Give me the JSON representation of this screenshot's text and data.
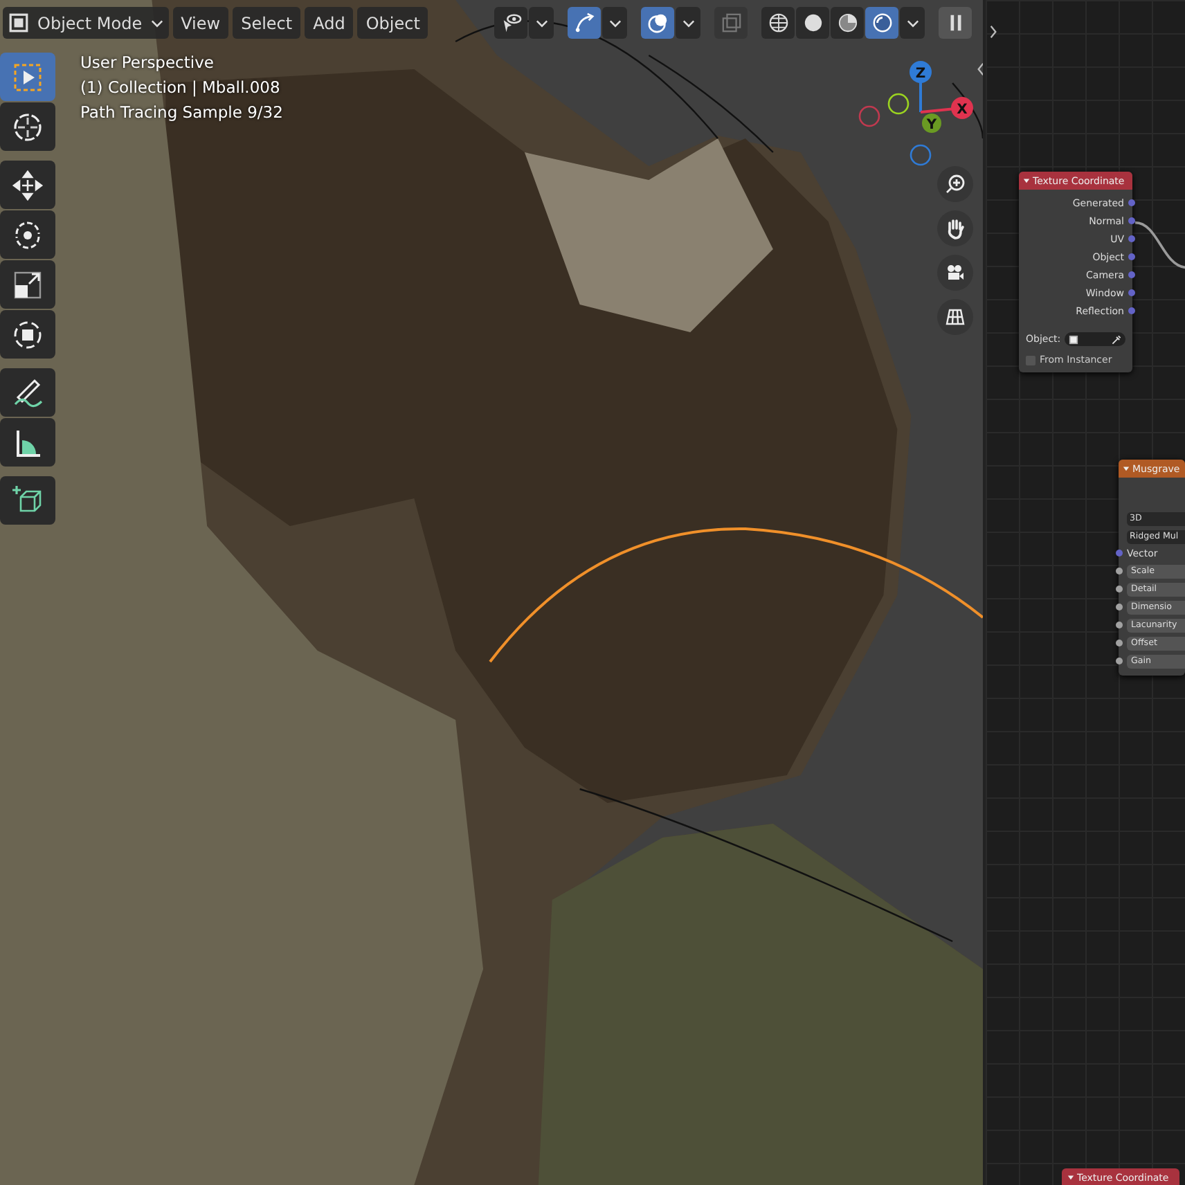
{
  "header": {
    "mode": "Object Mode",
    "menus": [
      "View",
      "Select",
      "Add",
      "Object"
    ],
    "toggles": [
      {
        "kind": "visibility",
        "on": false
      },
      {
        "kind": "gizmo",
        "on": true
      },
      {
        "kind": "overlay",
        "on": true
      },
      {
        "kind": "xray",
        "on": false
      }
    ],
    "shading": [
      {
        "kind": "wireframe",
        "selected": false
      },
      {
        "kind": "solid",
        "selected": false
      },
      {
        "kind": "material",
        "selected": false
      },
      {
        "kind": "rendered",
        "selected": true
      }
    ]
  },
  "overlay_text": [
    "User Perspective",
    "(1) Collection | Mball.008",
    "Path Tracing Sample 9/32"
  ],
  "tools": [
    {
      "kind": "select",
      "selected": true
    },
    {
      "kind": "cursor",
      "selected": false
    },
    {
      "kind": "move",
      "selected": false
    },
    {
      "kind": "rotate",
      "selected": false
    },
    {
      "kind": "scale",
      "selected": false
    },
    {
      "kind": "transform",
      "selected": false
    },
    {
      "kind": "annotate",
      "selected": false
    },
    {
      "kind": "measure",
      "selected": false
    },
    {
      "kind": "add-cube",
      "selected": false
    }
  ],
  "gizmo": {
    "z": "Z",
    "x": "X",
    "y": "Y"
  },
  "nodes": {
    "texture_coordinate": {
      "title": "Texture Coordinate",
      "outputs": [
        "Generated",
        "Normal",
        "UV",
        "Object",
        "Camera",
        "Window",
        "Reflection"
      ],
      "object_label": "Object:",
      "from_instancer": {
        "label": "From Instancer",
        "checked": false
      }
    },
    "musgrave": {
      "title": "Musgrave",
      "dropdowns": [
        "3D",
        "Ridged Mul"
      ],
      "input": "Vector",
      "fields": [
        "Scale",
        "Detail",
        "Dimensio",
        "Lacunarity",
        "Offset",
        "Gain"
      ]
    },
    "bottom_node": {
      "title": "Texture Coordinate"
    }
  }
}
